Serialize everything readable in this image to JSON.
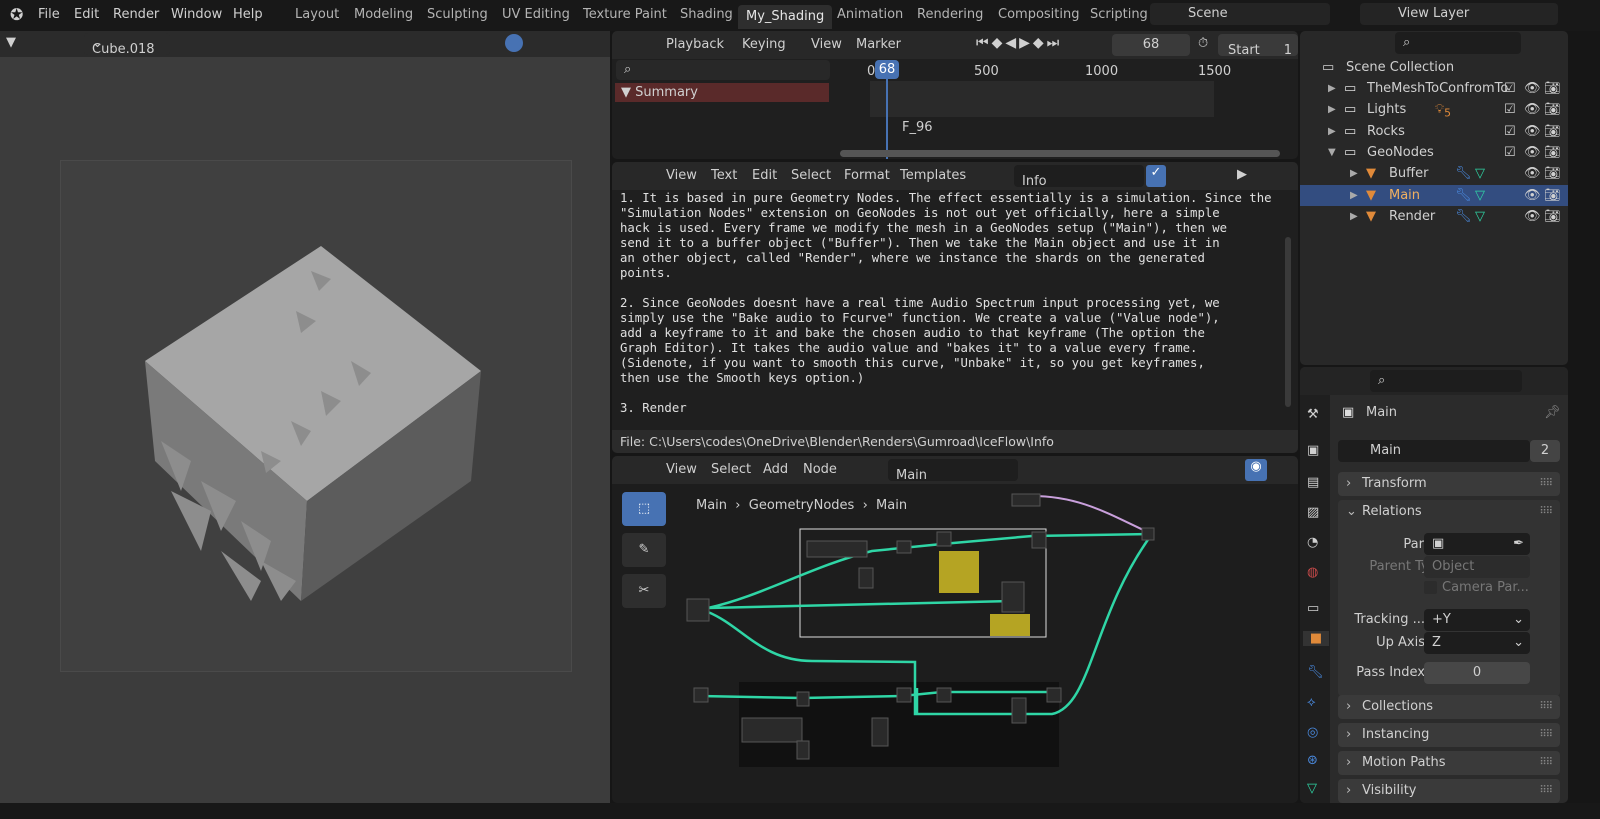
{
  "menu": [
    "File",
    "Edit",
    "Render",
    "Window",
    "Help"
  ],
  "workspaces": [
    "Layout",
    "Modeling",
    "Sculpting",
    "UV Editing",
    "Texture Paint",
    "Shading",
    "My_Shading",
    "Animation",
    "Rendering",
    "Compositing",
    "Scripting"
  ],
  "active_workspace": "My_Shading",
  "scene": "Scene",
  "view_layer": "View Layer",
  "viewport": {
    "object": "Cube.018"
  },
  "timeline": {
    "menus": [
      "Playback",
      "Keying",
      "View",
      "Marker"
    ],
    "current_frame": "68",
    "start_label": "Start",
    "start_value": "1",
    "ruler": [
      "0",
      "500",
      "1000",
      "1500"
    ],
    "summary": "Summary",
    "marker": "F_96"
  },
  "text_editor": {
    "menus": [
      "View",
      "Text",
      "Edit",
      "Select",
      "Format",
      "Templates"
    ],
    "text_name": "Info",
    "lines": [
      "1. It is based in pure Geometry Nodes. The effect essentially is a simulation. Since the",
      "\"Simulation Nodes\" extension on GeoNodes is not out yet officially, here a simple",
      "hack is used. Every frame we modify the mesh in a GeoNodes setup (\"Main\"), then we",
      "send it to a buffer object (\"Buffer\"). Then we take the Main object and use it in",
      "an other object, called \"Render\", where we instance the shards on the generated",
      "points.",
      "",
      "2. Since GeoNodes doesnt have a real time Audio Spectrum input processing yet, we",
      "simply use the \"Bake audio to Fcurve\" function. We create a value (\"Value node\"),",
      "add a keyframe to it and bake the chosen audio to that keyframe (The option the",
      "Graph Editor). It takes the audio value and \"bakes it\" to a value every frame.",
      "(Sidenote, if you want to smooth this curve, \"Unbake\" it, so you get keyframes,",
      "then use the Smooth keys option.)",
      "",
      "3. Render"
    ],
    "file_path": "File: C:\\Users\\codes\\OneDrive\\Blender\\Renders\\Gumroad\\IceFlow\\Info"
  },
  "node_editor": {
    "menus": [
      "View",
      "Select",
      "Add",
      "Node"
    ],
    "node_tree": "Main",
    "breadcrumb": [
      "Main",
      "GeometryNodes",
      "Main"
    ]
  },
  "outliner": {
    "root": "Scene Collection",
    "items": [
      {
        "label": "TheMeshToConfromTo",
        "depth": 1
      },
      {
        "label": "Lights",
        "depth": 1,
        "badge": "5"
      },
      {
        "label": "Rocks",
        "depth": 1
      },
      {
        "label": "GeoNodes",
        "depth": 1
      },
      {
        "label": "Buffer",
        "depth": 2
      },
      {
        "label": "Main",
        "depth": 2,
        "selected": true
      },
      {
        "label": "Render",
        "depth": 2
      }
    ]
  },
  "properties": {
    "object_name": "Main",
    "data_name": "Main",
    "users": "2",
    "panels": {
      "transform": "Transform",
      "relations": "Relations",
      "collections": "Collections",
      "instancing": "Instancing",
      "motion_paths": "Motion Paths",
      "visibility": "Visibility"
    },
    "parent_label": "Parent",
    "parent_type_label": "Parent Type",
    "parent_type": "Object",
    "camera_parent": "Camera Par...",
    "tracking_label": "Tracking ...",
    "tracking": "+Y",
    "up_axis_label": "Up Axis",
    "up_axis": "Z",
    "pass_index_label": "Pass Index",
    "pass_index": "0"
  },
  "colors": {
    "accent": "#4772b3",
    "selected_row": "#334d80",
    "summary": "#5a2a2a",
    "wire": "#2fd6a6",
    "object": "#e08a3a"
  }
}
